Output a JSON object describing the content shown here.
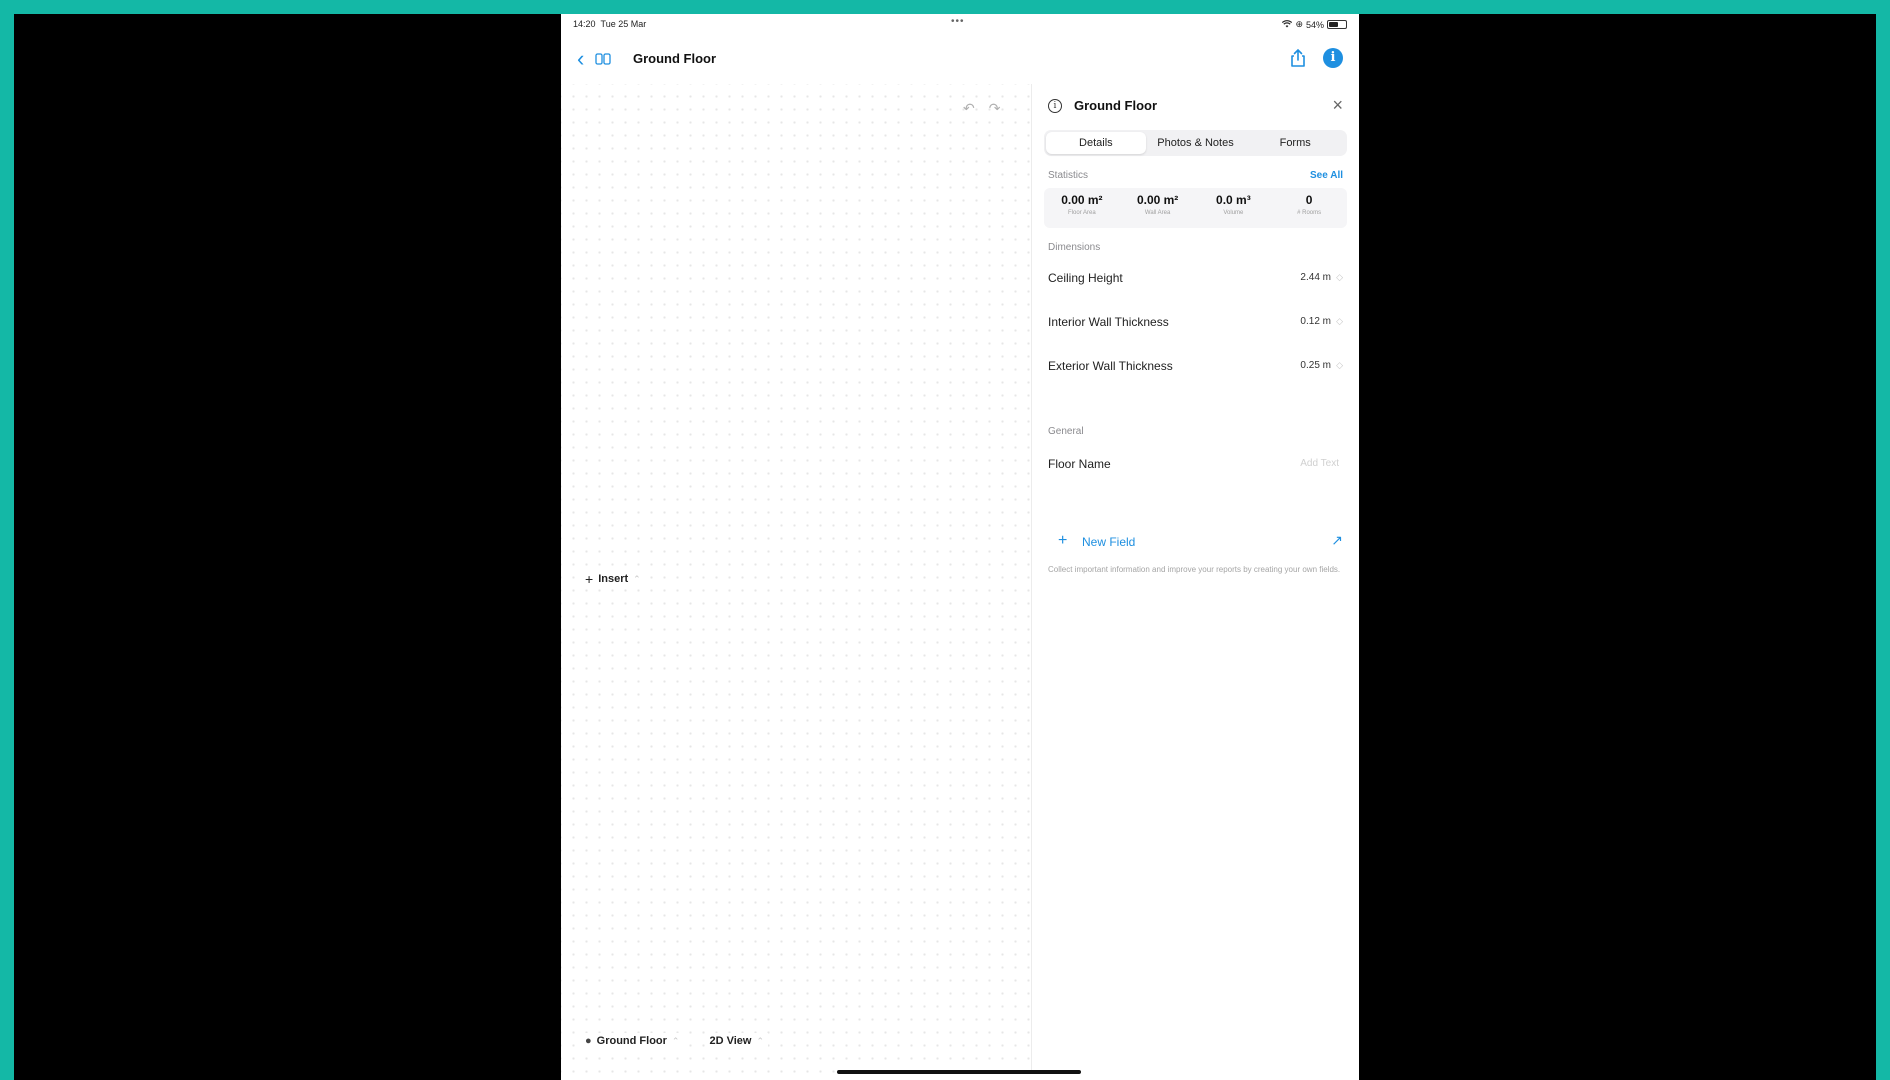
{
  "status_bar": {
    "time": "14:20",
    "date": "Tue 25 Mar",
    "multitask_dots": "•••",
    "wifi_icon": "wifi-icon",
    "battery_percent": "54%",
    "battery_level": 0.54
  },
  "nav": {
    "title": "Ground Floor",
    "back_icon": "chevron-left-icon",
    "floors_icon": "floors-icon",
    "share_icon": "share-icon",
    "info_icon": "info-icon"
  },
  "canvas": {
    "undo_icon": "undo-icon",
    "redo_icon": "redo-icon",
    "insert_label": "Insert",
    "floor_selector": "Ground Floor",
    "view_selector": "2D View"
  },
  "panel": {
    "title": "Ground Floor",
    "tabs": [
      {
        "label": "Details",
        "active": true
      },
      {
        "label": "Photos & Notes",
        "active": false
      },
      {
        "label": "Forms",
        "active": false
      }
    ],
    "statistics_label": "Statistics",
    "see_all": "See All",
    "stats": [
      {
        "value": "0.00 m²",
        "label": "Floor Area"
      },
      {
        "value": "0.00 m²",
        "label": "Wall Area"
      },
      {
        "value": "0.0 m³",
        "label": "Volume"
      },
      {
        "value": "0",
        "label": "# Rooms"
      }
    ],
    "dimensions_label": "Dimensions",
    "dimensions": [
      {
        "label": "Ceiling Height",
        "value": "2.44 m"
      },
      {
        "label": "Interior Wall Thickness",
        "value": "0.12 m"
      },
      {
        "label": "Exterior Wall Thickness",
        "value": "0.25 m"
      }
    ],
    "general_label": "General",
    "floor_name_label": "Floor Name",
    "floor_name_placeholder": "Add Text",
    "new_field_label": "New Field",
    "help_text": "Collect important information and improve your reports by creating your own fields."
  },
  "colors": {
    "accent": "#1e8fe0",
    "frame_border": "#14b8a6"
  }
}
